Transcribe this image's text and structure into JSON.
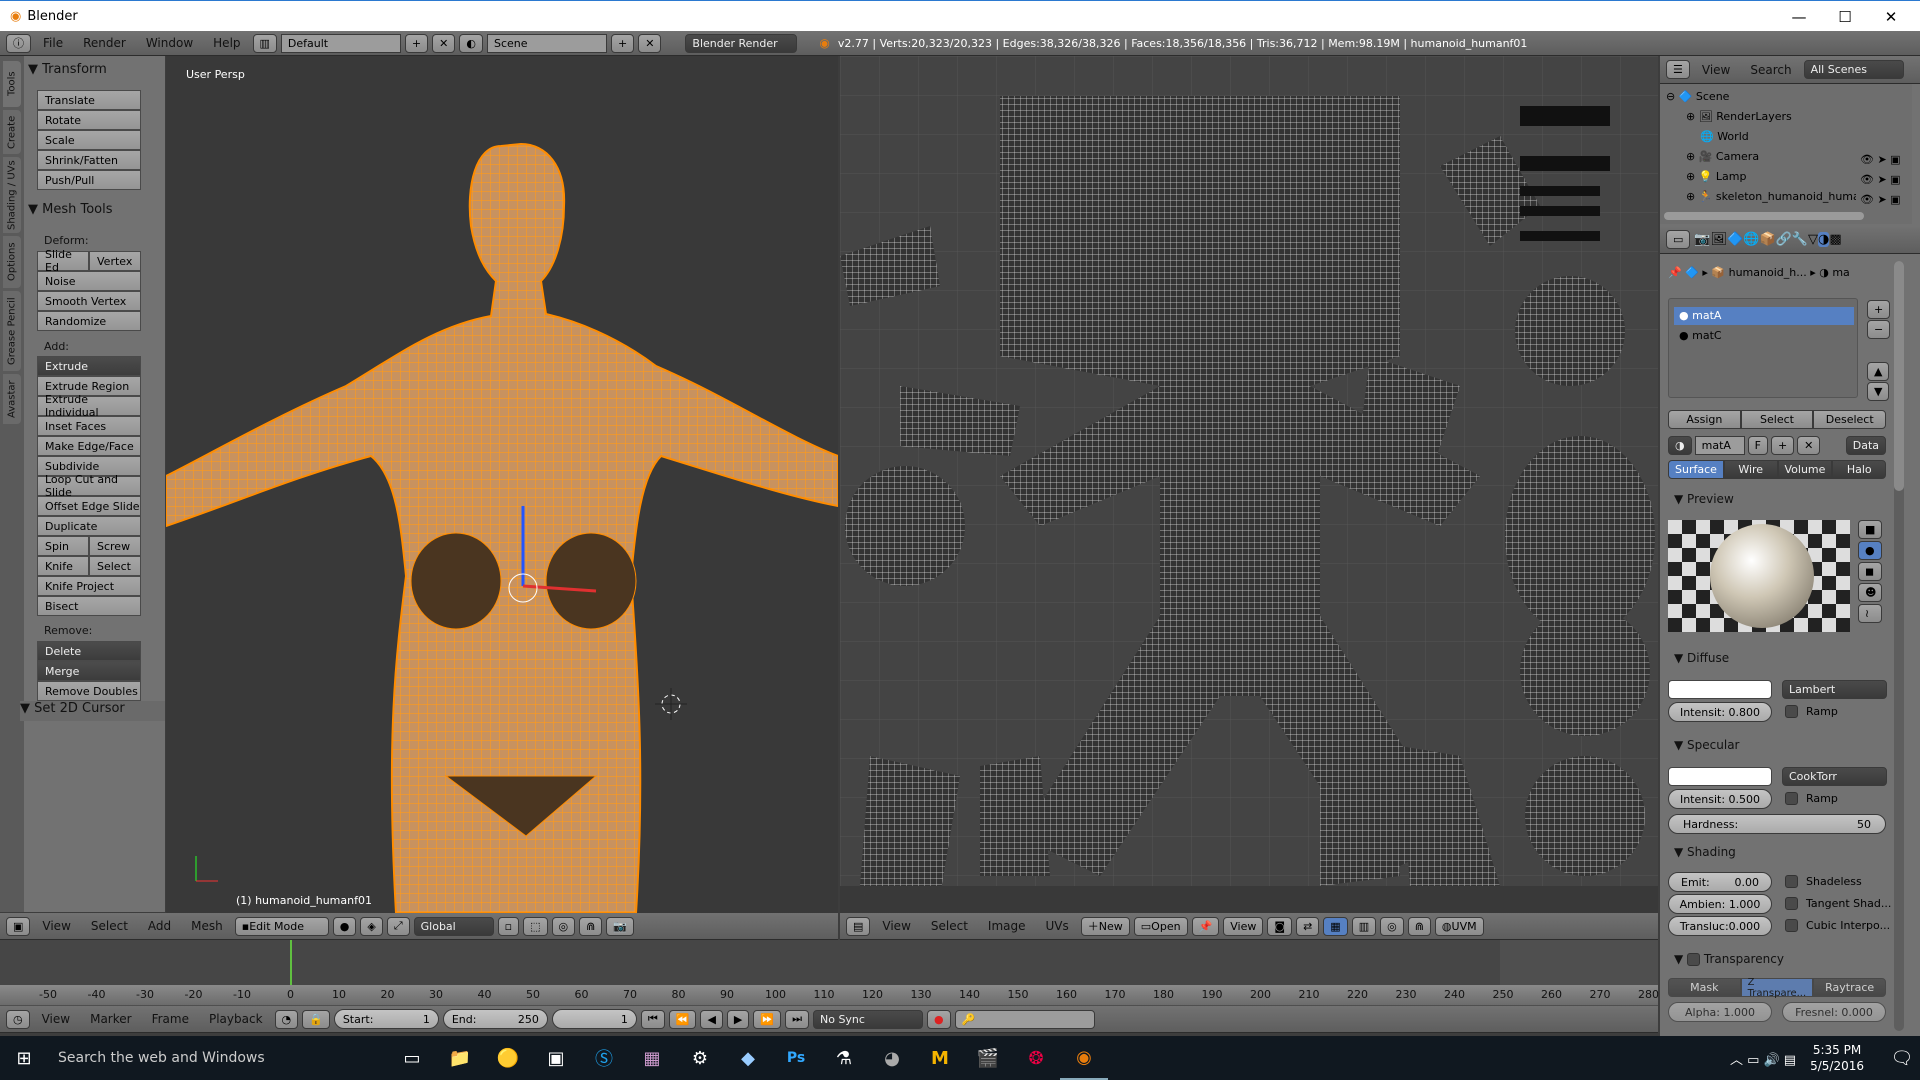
{
  "window": {
    "title": "Blender",
    "minimize": "—",
    "maximize": "☐",
    "close": "✕"
  },
  "info_header": {
    "menus": [
      "File",
      "Render",
      "Window",
      "Help"
    ],
    "layout": "Default",
    "scene": "Scene",
    "engine": "Blender Render",
    "stats": "v2.77 | Verts:20,323/20,323 | Edges:38,326/38,326 | Faces:18,356/18,356 | Tris:36,712 | Mem:98.19M | humanoid_humanf01"
  },
  "tool_shelf": {
    "tabs": [
      "Tools",
      "Create",
      "Shading / UVs",
      "Options",
      "Grease Pencil",
      "Avastar"
    ],
    "transform": {
      "title": "Transform",
      "buttons": [
        "Translate",
        "Rotate",
        "Scale",
        "Shrink/Fatten",
        "Push/Pull"
      ]
    },
    "mesh_tools": {
      "title": "Mesh Tools",
      "deform_label": "Deform:",
      "slide_edge": "Slide Ed",
      "vertex": "Vertex",
      "deform": [
        "Noise",
        "Smooth Vertex",
        "Randomize"
      ],
      "add_label": "Add:",
      "extrude": "Extrude",
      "add": [
        "Extrude Region",
        "Extrude Individual",
        "Inset Faces",
        "Make Edge/Face",
        "Subdivide",
        "Loop Cut and Slide",
        "Offset Edge Slide",
        "Duplicate"
      ],
      "spin": "Spin",
      "screw": "Screw",
      "knife": "Knife",
      "select": "Select",
      "knife_project": "Knife Project",
      "bisect": "Bisect",
      "remove_label": "Remove:",
      "delete": "Delete",
      "merge": "Merge",
      "remove_doubles": "Remove Doubles"
    },
    "cursor_panel": "Set 2D Cursor"
  },
  "viewport": {
    "view_name": "User Persp",
    "object_label": "(1) humanoid_humanf01",
    "accent": "#ff8c00"
  },
  "view3d_header": {
    "menus": [
      "View",
      "Select",
      "Add",
      "Mesh"
    ],
    "mode": "Edit Mode",
    "orientation": "Global"
  },
  "uv_header": {
    "menus": [
      "View",
      "Select",
      "Image",
      "UVs"
    ],
    "new": "New",
    "open": "Open",
    "view": "View",
    "uvmap": "UVM"
  },
  "timeline": {
    "ticks": [
      -50,
      -40,
      -30,
      -20,
      -10,
      0,
      10,
      20,
      30,
      40,
      50,
      60,
      70,
      80,
      90,
      100,
      110,
      120,
      130,
      140,
      150,
      160,
      170,
      180,
      190,
      200,
      210,
      220,
      230,
      240,
      250,
      260,
      270,
      280
    ],
    "current_frame": 0
  },
  "timeline_header": {
    "menus": [
      "View",
      "Marker",
      "Frame",
      "Playback"
    ],
    "start_label": "Start:",
    "start": "1",
    "end_label": "End:",
    "end": "250",
    "frame": "1",
    "sync": "No Sync"
  },
  "outliner": {
    "menus": [
      "View",
      "Search"
    ],
    "filter": "All Scenes",
    "items": [
      "Scene",
      "RenderLayers",
      "World",
      "Camera",
      "Lamp",
      "skeleton_humanoid_humar"
    ]
  },
  "properties": {
    "breadcrumb_object": "humanoid_h...",
    "breadcrumb_material": "ma",
    "materials": [
      "matA",
      "matC"
    ],
    "assign": "Assign",
    "select": "Select",
    "deselect": "Deselect",
    "material_name": "matA",
    "fake_user": "F",
    "data": "Data",
    "tabs": [
      "Surface",
      "Wire",
      "Volume",
      "Halo"
    ],
    "preview": "Preview",
    "diffuse": {
      "title": "Diffuse",
      "shader": "Lambert",
      "intensity": "Intensit: 0.800",
      "intensity_value": 0.8,
      "ramp": "Ramp"
    },
    "specular": {
      "title": "Specular",
      "shader": "CookTorr",
      "intensity": "Intensit: 0.500",
      "intensity_value": 0.5,
      "ramp": "Ramp",
      "hardness_label": "Hardness:",
      "hardness": "50"
    },
    "shading": {
      "title": "Shading",
      "emit": "Emit:",
      "emit_value": "0.00",
      "ambient": "Ambien: 1.000",
      "transluc": "Transluc:0.000",
      "shadeless": "Shadeless",
      "tangent": "Tangent Shad...",
      "cubic": "Cubic Interpo..."
    },
    "transparency": {
      "title": "Transparency",
      "modes": [
        "Mask",
        "Z Transpare...",
        "Raytrace"
      ],
      "alpha": "Alpha:   1.000",
      "fresnel": "Fresnel: 0.000"
    },
    "selected_color": "#5680c2"
  },
  "taskbar": {
    "search": "Search the web and Windows",
    "time": "5:35 PM",
    "date": "5/5/2016"
  }
}
